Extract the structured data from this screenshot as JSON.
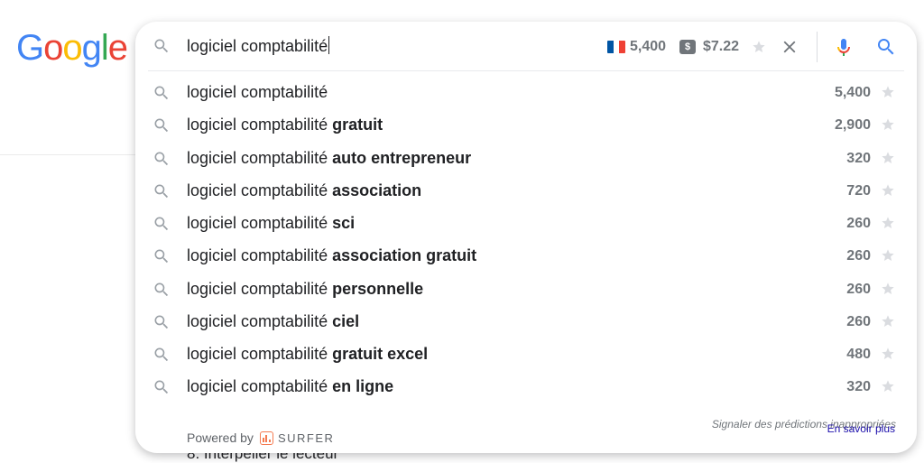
{
  "logo": {
    "letters": [
      "G",
      "o",
      "o",
      "g",
      "l",
      "e"
    ],
    "colors": [
      "#4285f4",
      "#ea4335",
      "#fbbc05",
      "#4285f4",
      "#34a853",
      "#ea4335"
    ]
  },
  "search": {
    "query": "logiciel comptabilité",
    "volume": "5,400",
    "cpc_badge": "$",
    "cpc": "$7.22",
    "flag_colors": [
      "#0055a4",
      "#ffffff",
      "#ef4135"
    ]
  },
  "suggestions": [
    {
      "base": "logiciel comptabilité",
      "bold": "",
      "volume": "5,400"
    },
    {
      "base": "logiciel comptabilité",
      "bold": "gratuit",
      "volume": "2,900"
    },
    {
      "base": "logiciel comptabilité",
      "bold": "auto entrepreneur",
      "volume": "320"
    },
    {
      "base": "logiciel comptabilité",
      "bold": "association",
      "volume": "720"
    },
    {
      "base": "logiciel comptabilité",
      "bold": "sci",
      "volume": "260"
    },
    {
      "base": "logiciel comptabilité",
      "bold": "association gratuit",
      "volume": "260"
    },
    {
      "base": "logiciel comptabilité",
      "bold": "personnelle",
      "volume": "260"
    },
    {
      "base": "logiciel comptabilité",
      "bold": "ciel",
      "volume": "260"
    },
    {
      "base": "logiciel comptabilité",
      "bold": "gratuit excel",
      "volume": "480"
    },
    {
      "base": "logiciel comptabilité",
      "bold": "en ligne",
      "volume": "320"
    }
  ],
  "footer": {
    "report": "Signaler des prédictions inappropriées",
    "learn_more": "En savoir plus",
    "powered_by": "Powered by",
    "brand": "SURFER",
    "brand_color": "#f47a50"
  },
  "background": {
    "partial_text": "8. Interpeller le lecteur"
  }
}
